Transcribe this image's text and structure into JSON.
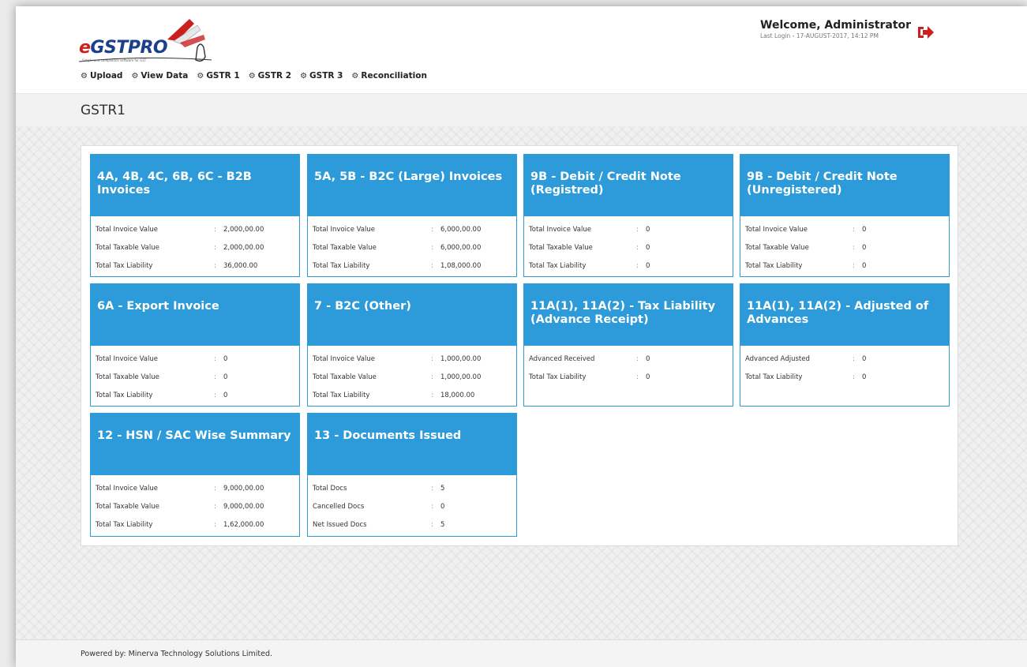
{
  "brand": {
    "logo_e": "e",
    "logo_rest": "GSTPRO",
    "tagline": "Simple and compliance software for GST"
  },
  "header": {
    "welcome": "Welcome, Administrator",
    "last_login": "Last Login - 17-AUGUST-2017, 14:12 PM",
    "logout_icon": "logout-icon"
  },
  "nav": [
    {
      "label": "Upload"
    },
    {
      "label": "View Data"
    },
    {
      "label": "GSTR 1"
    },
    {
      "label": "GSTR 2"
    },
    {
      "label": "GSTR 3"
    },
    {
      "label": "Reconciliation"
    }
  ],
  "page_title": "GSTR1",
  "colors": {
    "accent": "#2d9ad9",
    "logout": "#cc2020"
  },
  "cards": [
    {
      "title": "4A, 4B, 4C, 6B, 6C - B2B Invoices",
      "rows": [
        [
          "Total Invoice Value",
          "2,000,00.00"
        ],
        [
          "Total Taxable Value",
          "2,000,00.00"
        ],
        [
          "Total Tax Liability",
          "36,000.00"
        ]
      ]
    },
    {
      "title": "5A, 5B - B2C (Large) Invoices",
      "rows": [
        [
          "Total Invoice Value",
          "6,000,00.00"
        ],
        [
          "Total Taxable Value",
          "6,000,00.00"
        ],
        [
          "Total Tax Liability",
          "1,08,000.00"
        ]
      ]
    },
    {
      "title": "9B - Debit / Credit Note (Registred)",
      "rows": [
        [
          "Total Invoice Value",
          "0"
        ],
        [
          "Total Taxable Value",
          "0"
        ],
        [
          "Total Tax Liability",
          "0"
        ]
      ]
    },
    {
      "title": "9B - Debit / Credit Note (Unregistered)",
      "rows": [
        [
          "Total Invoice Value",
          "0"
        ],
        [
          "Total Taxable Value",
          "0"
        ],
        [
          "Total Tax Liability",
          "0"
        ]
      ]
    },
    {
      "title": "6A - Export Invoice",
      "rows": [
        [
          "Total Invoice Value",
          "0"
        ],
        [
          "Total Taxable Value",
          "0"
        ],
        [
          "Total Tax Liability",
          "0"
        ]
      ]
    },
    {
      "title": "7 - B2C (Other)",
      "rows": [
        [
          "Total Invoice Value",
          "1,000,00.00"
        ],
        [
          "Total Taxable Value",
          "1,000,00.00"
        ],
        [
          "Total Tax Liability",
          "18,000.00"
        ]
      ]
    },
    {
      "title": "11A(1), 11A(2) - Tax Liability (Advance Receipt)",
      "rows": [
        [
          "Advanced Received",
          "0"
        ],
        [
          "Total Tax Liability",
          "0"
        ]
      ]
    },
    {
      "title": "11A(1), 11A(2) - Adjusted of Advances",
      "rows": [
        [
          "Advanced Adjusted",
          "0"
        ],
        [
          "Total Tax Liability",
          "0"
        ]
      ]
    },
    {
      "title": "12 - HSN / SAC Wise Summary",
      "rows": [
        [
          "Total Invoice Value",
          "9,000,00.00"
        ],
        [
          "Total Taxable Value",
          "9,000,00.00"
        ],
        [
          "Total Tax Liability",
          "1,62,000.00"
        ]
      ]
    },
    {
      "title": "13 - Documents Issued",
      "rows": [
        [
          "Total Docs",
          "5"
        ],
        [
          "Cancelled Docs",
          "0"
        ],
        [
          "Net Issued Docs",
          "5"
        ]
      ]
    }
  ],
  "footer": "Powered by: Minerva Technology Solutions Limited."
}
